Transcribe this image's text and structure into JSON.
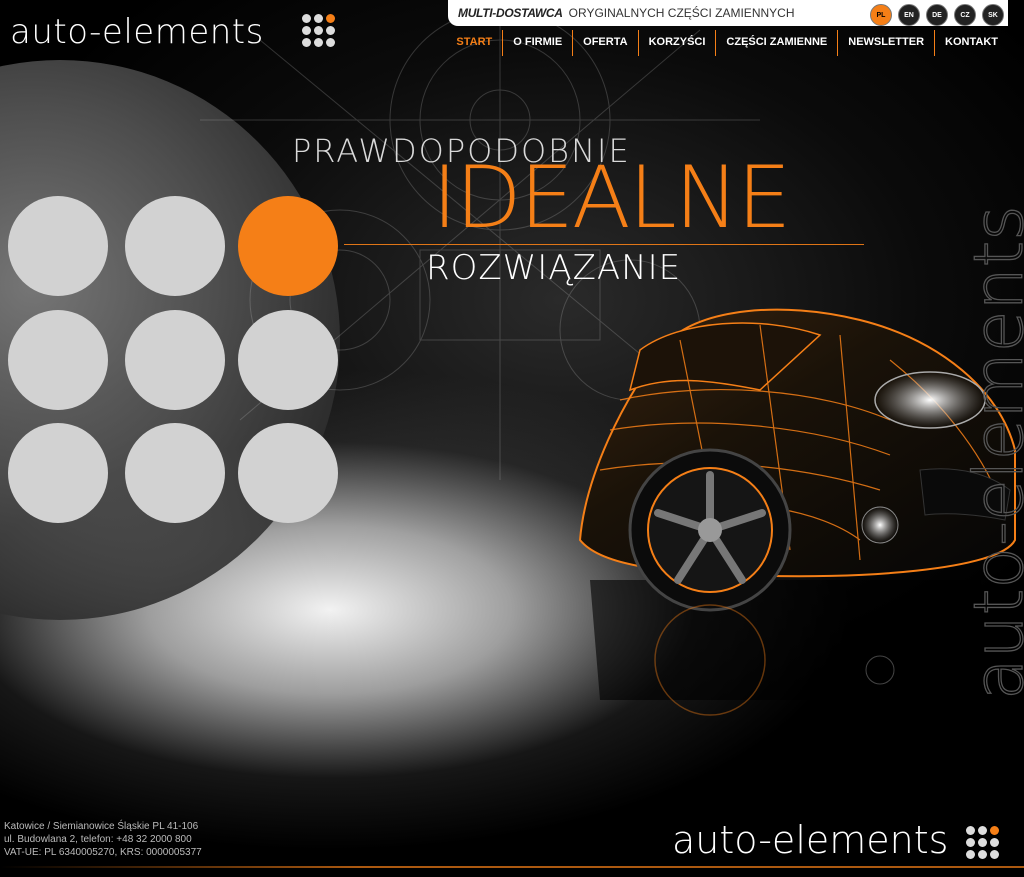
{
  "header": {
    "logo_text": "auto-elements",
    "tagline_bold": "MULTI-DOSTAWCA",
    "tagline_rest": "ORYGINALNYCH CZĘŚCI ZAMIENNYCH",
    "languages": [
      "PL",
      "EN",
      "DE",
      "CZ",
      "SK"
    ],
    "active_language": "PL"
  },
  "nav": {
    "items": [
      {
        "label": "START"
      },
      {
        "label": "O FIRMIE"
      },
      {
        "label": "OFERTA"
      },
      {
        "label": "KORZYŚCI"
      },
      {
        "label": "CZĘŚCI ZAMIENNE"
      },
      {
        "label": "NEWSLETTER"
      },
      {
        "label": "KONTAKT"
      }
    ],
    "active": "START"
  },
  "hero": {
    "line1": "PRAWDOPODOBNIE",
    "line2": "IDEALNE",
    "line3": "ROZWIĄZANIE",
    "side_text": "auto-elements"
  },
  "footer": {
    "address_line1": "Katowice / Siemianowice Śląskie PL 41-106",
    "address_line2": "ul. Budowlana 2,   telefon:  +48 32 2000 800",
    "address_line3": "VAT-UE:  PL  6340005270,    KRS:  0000005377",
    "logo_text": "auto-elements"
  },
  "colors": {
    "accent": "#f57f17",
    "background": "#000000",
    "dot": "#d2d2d2"
  }
}
